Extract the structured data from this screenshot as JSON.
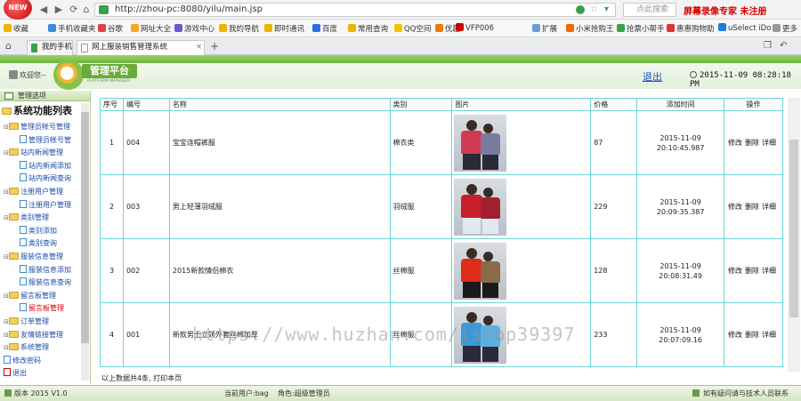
{
  "browser": {
    "badge": "NEW",
    "url": "http://zhou-pc:8080/yilu/main.jsp",
    "search_placeholder": "点此搜索",
    "recorder_text": "屏幕录像专家 未注册",
    "bookmarks": [
      {
        "label": "收藏",
        "color": "#f0b400"
      },
      {
        "label": "手机收藏夹",
        "color": "#3a8be0"
      },
      {
        "label": "谷歌",
        "color": "#d44"
      },
      {
        "label": "网址大全",
        "color": "#f5a623"
      },
      {
        "label": "游戏中心",
        "color": "#6a5acd"
      },
      {
        "label": "我的导航",
        "color": "#f0b400"
      },
      {
        "label": "即时通讯",
        "color": "#f0b400"
      },
      {
        "label": "百度",
        "color": "#2b6de0"
      },
      {
        "label": "常用查询",
        "color": "#f0b400"
      },
      {
        "label": "QQ空间",
        "color": "#f5c000"
      },
      {
        "label": "优趣",
        "color": "#f07a00"
      },
      {
        "label": "VFP006",
        "color": "#c00"
      },
      {
        "label": "扩展",
        "color": "#6a9cd6"
      },
      {
        "label": "小米抢购王",
        "color": "#e86a00"
      },
      {
        "label": "抢票小帮手",
        "color": "#3aa04a"
      },
      {
        "label": "惠惠购物助",
        "color": "#d33"
      },
      {
        "label": "uSelect iDo",
        "color": "#1c7ed6"
      },
      {
        "label": "更多",
        "color": "#999"
      }
    ],
    "tabs": [
      {
        "label": "我的手机",
        "active": false
      },
      {
        "label": "网上服装销售管理系统",
        "active": true
      }
    ]
  },
  "header": {
    "welcome": "欢迎您--",
    "logo_title": "管理平台",
    "logo_sub": "PLATFORM MANAGER",
    "logout": "退出",
    "clock": "2015-11-09 08:28:18 PM"
  },
  "sidebar": {
    "title": "管理选项",
    "root": "系统功能列表",
    "items": [
      {
        "label": "管理员帐号管理",
        "kind": "folder",
        "depth": 1
      },
      {
        "label": "管理员帐号管",
        "kind": "leaf",
        "depth": 2
      },
      {
        "label": "站内新闻管理",
        "kind": "folder",
        "depth": 1
      },
      {
        "label": "站内新闻添加",
        "kind": "leaf",
        "depth": 2
      },
      {
        "label": "站内新闻查询",
        "kind": "leaf",
        "depth": 2
      },
      {
        "label": "注册用户管理",
        "kind": "folder",
        "depth": 1
      },
      {
        "label": "注册用户管理",
        "kind": "leaf",
        "depth": 2
      },
      {
        "label": "类别管理",
        "kind": "folder",
        "depth": 1
      },
      {
        "label": "类别添加",
        "kind": "leaf",
        "depth": 2
      },
      {
        "label": "类别查询",
        "kind": "leaf",
        "depth": 2
      },
      {
        "label": "服装信息管理",
        "kind": "folder",
        "depth": 1
      },
      {
        "label": "服装信息添加",
        "kind": "leaf",
        "depth": 2
      },
      {
        "label": "服装信息查询",
        "kind": "leaf",
        "depth": 2
      },
      {
        "label": "留言板管理",
        "kind": "folder",
        "depth": 1
      },
      {
        "label": "留言板管理",
        "kind": "leaf",
        "depth": 2,
        "hover": true
      },
      {
        "label": "订单管理",
        "kind": "folder",
        "depth": 1
      },
      {
        "label": "友情链接管理",
        "kind": "folder",
        "depth": 1
      },
      {
        "label": "系统管理",
        "kind": "folder",
        "depth": 1
      },
      {
        "label": "修改密码",
        "kind": "leaf",
        "depth": 1
      },
      {
        "label": "退出",
        "kind": "leaf",
        "depth": 1
      }
    ]
  },
  "table": {
    "headers": [
      "序号",
      "编号",
      "名称",
      "类别",
      "图片",
      "价格",
      "添加时间",
      "操作"
    ],
    "ops": [
      "修改",
      "删除",
      "详细"
    ],
    "rows": [
      {
        "seq": "1",
        "code": "004",
        "name": "宝宝连帽裤服",
        "category": "棉衣类",
        "price": "87",
        "time1": "2015-11-09",
        "time2": "20:10:45.987",
        "pic": [
          "#d23a52",
          "#2a2a36",
          "#7a7aa0"
        ]
      },
      {
        "seq": "2",
        "code": "003",
        "name": "男上轻薄羽绒服",
        "category": "羽绒服",
        "price": "229",
        "time1": "2015-11-09",
        "time2": "20:09:35.387",
        "pic": [
          "#c8202a",
          "#e0e8f0",
          "#a02030"
        ]
      },
      {
        "seq": "3",
        "code": "002",
        "name": "2015新款情侣棉衣",
        "category": "丝棉服",
        "price": "128",
        "time1": "2015-11-09 20:08:31.49",
        "time2": "",
        "pic": [
          "#e02a1a",
          "#1a1a1a",
          "#8a6a4a"
        ]
      },
      {
        "seq": "4",
        "code": "001",
        "name": "新款男士立领外套丝棉加厚",
        "category": "丝棉服",
        "price": "233",
        "time1": "2015-11-09 20:07:09.16",
        "time2": "",
        "pic": [
          "#3a9ad6",
          "#2a2a3a",
          "#5ab0e0"
        ]
      }
    ],
    "footnote": "以上数据共4条, 打印本页"
  },
  "status": {
    "version": "版本 2015 V1.0",
    "user": "当前用户:bag",
    "role": "角色:超级管理员",
    "contact": "如有疑问请与技术人员联系"
  },
  "watermark": "https://www.huzhan.com/ishop39397"
}
